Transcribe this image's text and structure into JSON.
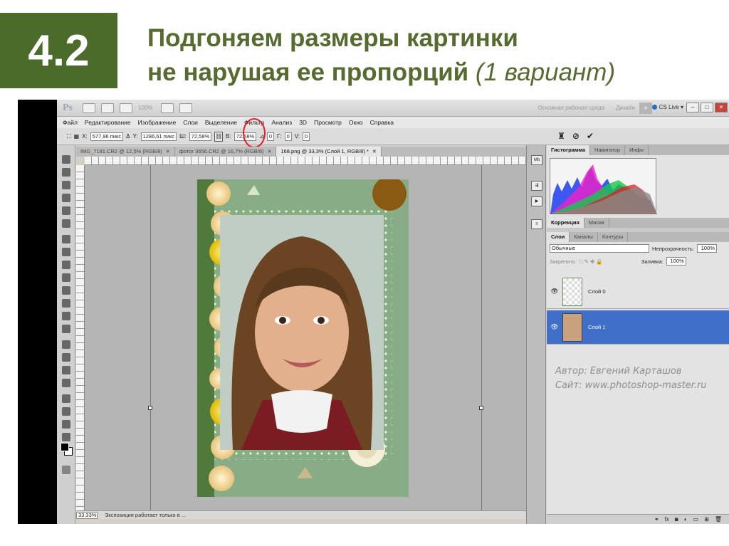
{
  "slide": {
    "number": "4.2",
    "title_line1": "Подгоняем размеры картинки",
    "title_line2_bold": "не нарушая ее пропорций",
    "title_line2_italic": " (1 вариант)"
  },
  "app": {
    "logo": "Ps",
    "zoom": "100%",
    "workspace": "Основная рабочая среда",
    "design": "Дизайн",
    "extensions": "»",
    "cs_live": "CS Live ▾"
  },
  "menu": [
    "Файл",
    "Редактирование",
    "Изображение",
    "Слои",
    "Выделение",
    "Фильтр",
    "Анализ",
    "3D",
    "Просмотр",
    "Окно",
    "Справка"
  ],
  "options": {
    "x_label": "X:",
    "x_value": "577,96 пикс",
    "y_label": "Y:",
    "y_value": "1286,61 пикс",
    "w_label": "Ш:",
    "w_value": "72,58%",
    "h_label": "В:",
    "h_value": "72,58%",
    "angle_value": "0",
    "g_label": "Г:",
    "g_value": "0",
    "v_label": "V:",
    "v_value": "0"
  },
  "doc_tabs": [
    {
      "label": "IMG_7181.CR2 @ 12,5% (RGB/8)",
      "active": false
    },
    {
      "label": "фотог 3656.CR2 @ 16,7% (RGB/8)",
      "active": false
    },
    {
      "label": "168.png @ 33,3% (Слой 1, RGB/8) *",
      "active": true
    }
  ],
  "status": {
    "zoom": "33.33%",
    "info": "Экспозиция работает только в ..."
  },
  "panels": {
    "top_tabs": [
      "Гистограмма",
      "Навигатор",
      "Инфо"
    ],
    "mid_tabs": [
      "Коррекция",
      "Маски"
    ],
    "layer_tabs": [
      "Слои",
      "Каналы",
      "Контуры"
    ],
    "blend_mode": "Обычные",
    "opacity_label": "Непрозрачность:",
    "opacity_value": "100%",
    "lock_label": "Закрепить:",
    "fill_label": "Заливка:",
    "fill_value": "100%",
    "layers": [
      {
        "name": "Слой 0",
        "selected": false
      },
      {
        "name": "Слой 1",
        "selected": true
      }
    ]
  },
  "credits": {
    "author": "Автор: Евгений Карташов",
    "site": "Сайт: www.photoshop-master.ru"
  },
  "colors": {
    "slide_accent": "#4a6b2a",
    "title": "#556b2f",
    "layer_selected": "#3f6fc8",
    "annotation": "#e0202a"
  }
}
